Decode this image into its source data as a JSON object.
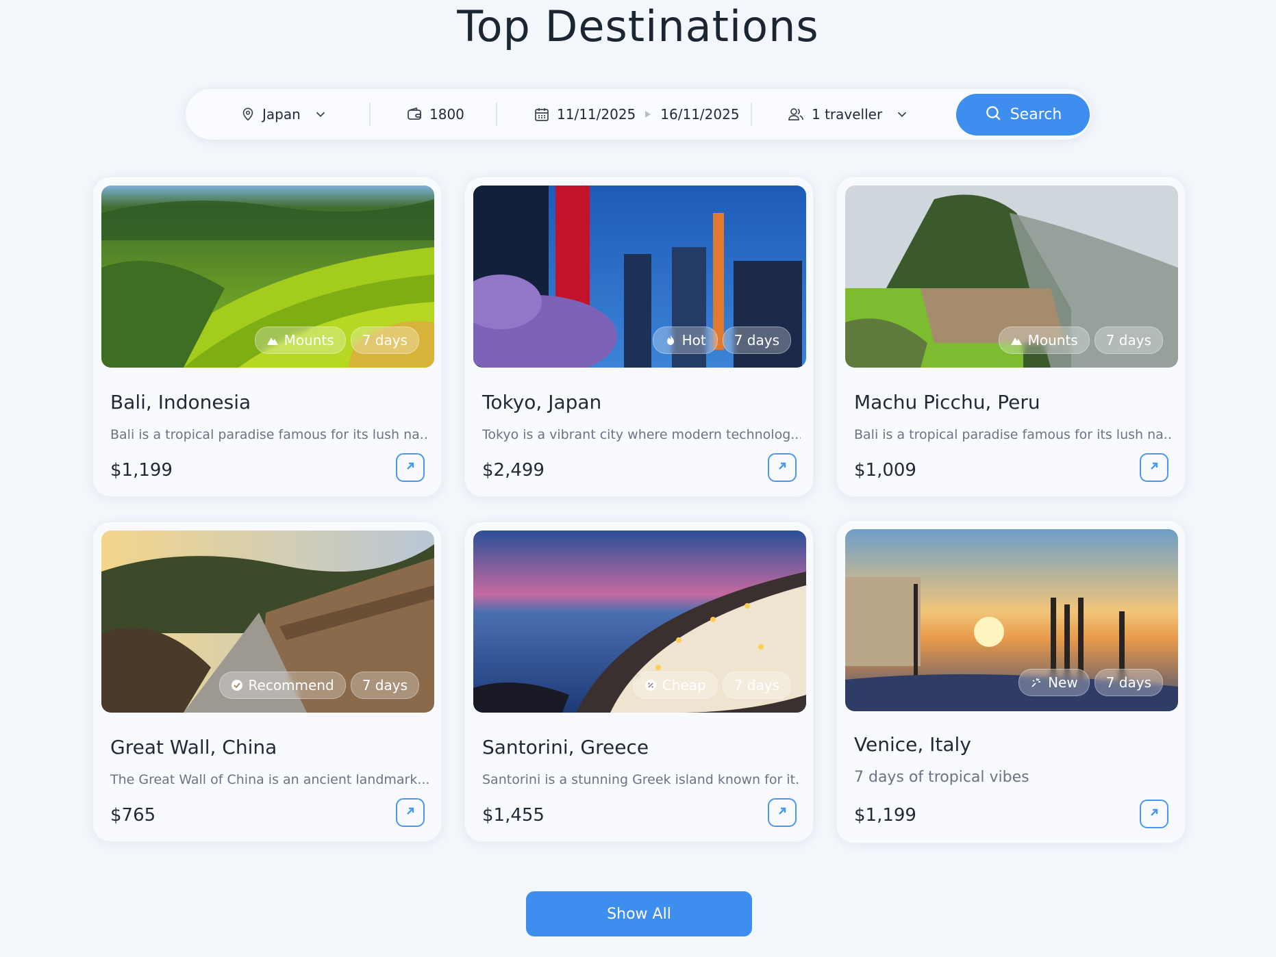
{
  "page": {
    "title": "Top Destinations"
  },
  "search": {
    "location": "Japan",
    "budget": "1800",
    "date_from": "11/11/2025",
    "date_to": "16/11/2025",
    "travellers": "1 traveller",
    "button_label": "Search",
    "accent": "#3e8ef0"
  },
  "cards": [
    {
      "name": "Bali, Indonesia",
      "desc": "Bali is a tropical paradise famous for its lush na...",
      "price": "$1,199",
      "tag": "Mounts",
      "tag_icon": "mountain-icon",
      "duration": "7 days"
    },
    {
      "name": "Tokyo, Japan",
      "desc": "Tokyo is a vibrant city where modern technolog...",
      "price": "$2,499",
      "tag": "Hot",
      "tag_icon": "fire-icon",
      "duration": "7 days"
    },
    {
      "name": "Machu Picchu, Peru",
      "desc": "Bali is a tropical paradise famous for its lush na...",
      "price": "$1,009",
      "tag": "Mounts",
      "tag_icon": "mountain-icon",
      "duration": "7 days"
    },
    {
      "name": "Great Wall, China",
      "desc": "The Great Wall of China is an ancient landmark...",
      "price": "$765",
      "tag": "Recommend",
      "tag_icon": "check-badge-icon",
      "duration": "7 days"
    },
    {
      "name": "Santorini, Greece",
      "desc": "Santorini is a stunning Greek island known for it...",
      "price": "$1,455",
      "tag": "Cheap",
      "tag_icon": "discount-icon",
      "duration": "7 days"
    },
    {
      "name": "Venice, Italy",
      "desc": "7 days of tropical vibes",
      "price": "$1,199",
      "tag": "New",
      "tag_icon": "sparkle-icon",
      "duration": "7 days"
    }
  ],
  "footer": {
    "show_all_label": "Show All"
  }
}
